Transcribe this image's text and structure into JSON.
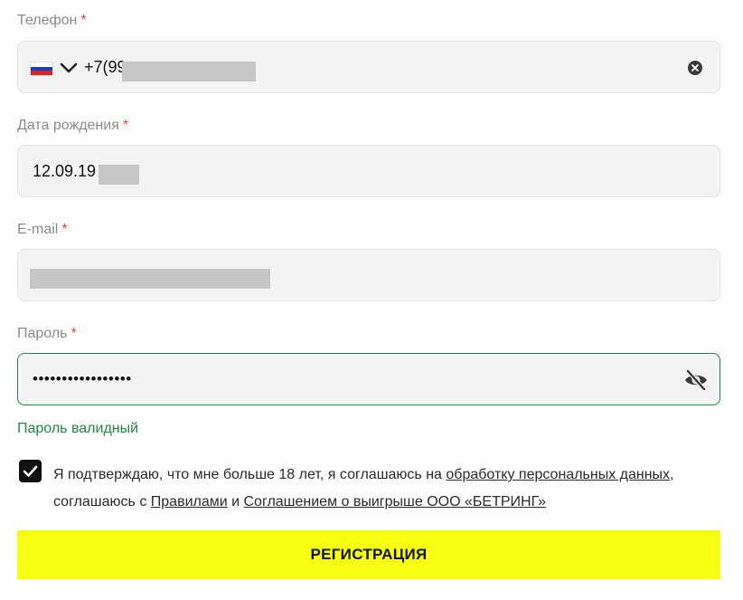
{
  "phone": {
    "label": "Телефон",
    "required_mark": "*",
    "country_flag": "ru-flag",
    "value": "+7(99"
  },
  "birthdate": {
    "label": "Дата рождения",
    "required_mark": "*",
    "value": "12.09.19"
  },
  "email": {
    "label": "E-mail",
    "required_mark": "*",
    "value": ""
  },
  "password": {
    "label": "Пароль",
    "required_mark": "*",
    "value": "•••••••••••••••••",
    "hint": "Пароль валидный"
  },
  "consent": {
    "checked": true,
    "text_1": "Я подтверждаю, что мне больше 18 лет, я соглашаюсь на ",
    "link_1": "обработку персональных данных",
    "text_2": ", соглашаюсь с ",
    "link_2": "Правилами",
    "text_3": " и ",
    "link_3": "Соглашением о выигрыше ООО «БЕТРИНГ»"
  },
  "submit": {
    "label": "РЕГИСТРАЦИЯ"
  },
  "colors": {
    "accent_yellow": "#f6ff11",
    "valid_green": "#1b8a43",
    "required_red": "#e0443e",
    "field_bg": "#f4f4f4"
  }
}
